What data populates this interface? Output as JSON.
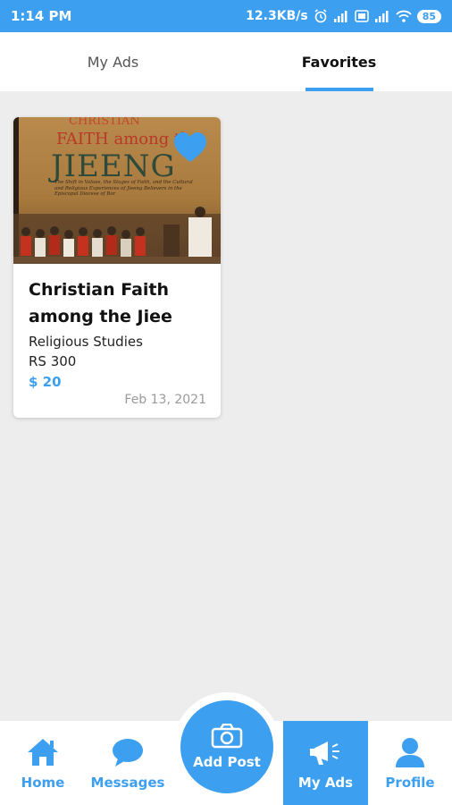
{
  "status_bar": {
    "time": "1:14 PM",
    "net_speed": "12.3KB/s",
    "battery": "85",
    "icons": [
      "alarm-icon",
      "signal-icon",
      "volte-icon",
      "signal-icon",
      "wifi-icon",
      "battery-icon"
    ]
  },
  "tabs": [
    {
      "label": "My Ads",
      "active": false
    },
    {
      "label": "Favorites",
      "active": true
    }
  ],
  "favorites": [
    {
      "title": "Christian Faith among the Jiee",
      "category": "Religious Studies",
      "price_local": "RS 300",
      "price_usd": "$ 20",
      "date": "Feb 13, 2021",
      "favorited": true,
      "cover_text": {
        "line1": "CHRISTIAN",
        "line2": "FAITH among the",
        "line3": "JIEENG",
        "subtitle": "The Shift in Values, the Stages of Faith, and the Cultural and Religious Experiences of Jieeng Believers in the Episcopal Diocese of Bor"
      }
    }
  ],
  "bottom_nav": {
    "items": [
      {
        "label": "Home",
        "icon": "home-icon",
        "active": false
      },
      {
        "label": "Messages",
        "icon": "chat-icon",
        "active": false
      },
      {
        "label": "Add Post",
        "icon": "camera-icon",
        "active": false
      },
      {
        "label": "My Ads",
        "icon": "megaphone-icon",
        "active": true
      },
      {
        "label": "Profile",
        "icon": "person-icon",
        "active": false
      }
    ]
  },
  "colors": {
    "accent": "#3d9ff0",
    "background": "#ededed",
    "date_text": "#9a9a9a"
  }
}
